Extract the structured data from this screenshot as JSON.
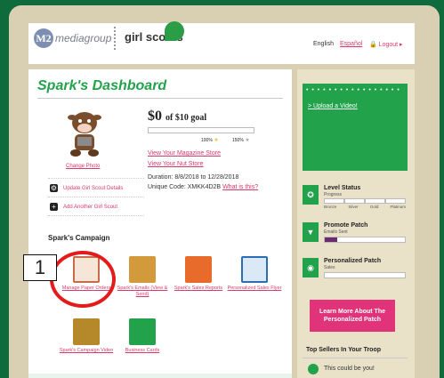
{
  "header": {
    "m2_logo": "M2",
    "media_text": "mediagroup",
    "gs_text": "girl scouts",
    "lang_english": "English",
    "lang_espanol": "Español",
    "logout": "Logout"
  },
  "dashboard": {
    "title": "Spark's Dashboard",
    "change_photo": "Change Photo",
    "goal_amount": "$0",
    "goal_text": "of $10 goal",
    "progress_fraction": 0,
    "pct_left": "100%",
    "pct_right": "150%",
    "magazine_link": "View Your Magazine Store",
    "nut_link": "View Your Nut Store",
    "duration": "Duration: 8/8/2018 to 12/28/2018",
    "unique_code": "Unique Code: XMKK4D2B",
    "what_is_this": "What is this?",
    "update_details": "Update Girl Scout Details",
    "add_another": "Add Another Girl Scout"
  },
  "campaign": {
    "title": "Spark's Campaign",
    "tiles": [
      {
        "label": "Manage Paper Orders",
        "icon": "clipboard-icon",
        "color": "#c96a4a"
      },
      {
        "label": "Spark's Emails (View & Send)",
        "icon": "book-icon",
        "color": "#d29a3b"
      },
      {
        "label": "Spark's Sales Reports",
        "icon": "chart-icon",
        "color": "#e86b2c"
      },
      {
        "label": "Personalized Sales Flyer",
        "icon": "flyer-icon",
        "color": "#2a6fb5"
      },
      {
        "label": "Spark's Campaign Video",
        "icon": "camera-icon",
        "color": "#b5892a"
      },
      {
        "label": "Business Cards",
        "icon": "cards-icon",
        "color": "#22a24b"
      }
    ]
  },
  "annotation": {
    "number": "1"
  },
  "sidebar": {
    "dots": "• • • • • • • • • • • • • • • • •",
    "upload_video": "> Upload a Video!",
    "level_status": "Level Status",
    "level_sub": "Progress",
    "level_labels": [
      "Bronze",
      "Silver",
      "Gold",
      "Platinum"
    ],
    "promote_patch": "Promote Patch",
    "promote_sub": "Emails Sent",
    "promote_fraction": 0.15,
    "personalized_patch": "Personalized Patch",
    "personalized_sub": "Sales",
    "personalized_fraction": 0,
    "learn_more": "Learn More About The Personalized Patch",
    "top_sellers": "Top Sellers In Your Troop",
    "could_be_you": "This could be you!"
  },
  "colors": {
    "accent_green": "#22a24b",
    "accent_pink": "#d83a6a",
    "annotation_red": "#e31b1b"
  }
}
